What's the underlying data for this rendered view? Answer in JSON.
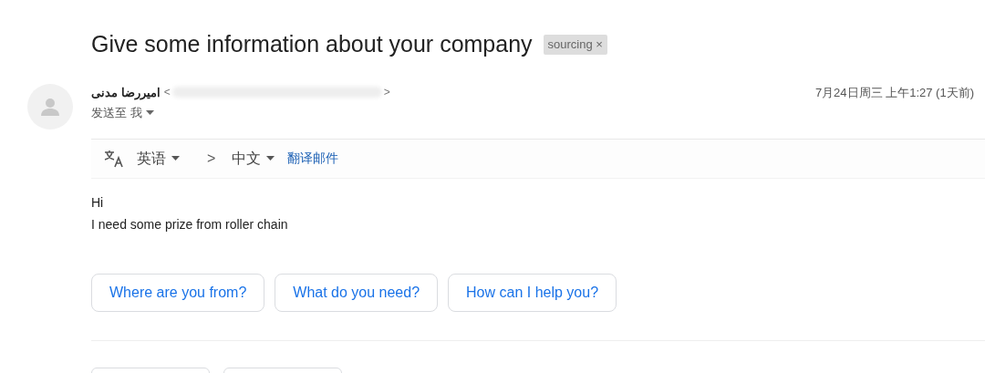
{
  "subject": "Give some information about your company",
  "label": {
    "text": "sourcing",
    "remove": "×"
  },
  "sender": {
    "name": "امیررضا مدنی",
    "email_open": "<",
    "email_close": ">",
    "recipient": "发送至 我",
    "date": "7月24日周三 上午1:27 (1天前)"
  },
  "translate": {
    "from": "英语",
    "arrow": ">",
    "to": "中文",
    "action": "翻译邮件"
  },
  "body": [
    "Hi",
    "I need some prize from roller chain"
  ],
  "smart_replies": [
    "Where are you from?",
    "What do you need?",
    "How can I help you?"
  ]
}
